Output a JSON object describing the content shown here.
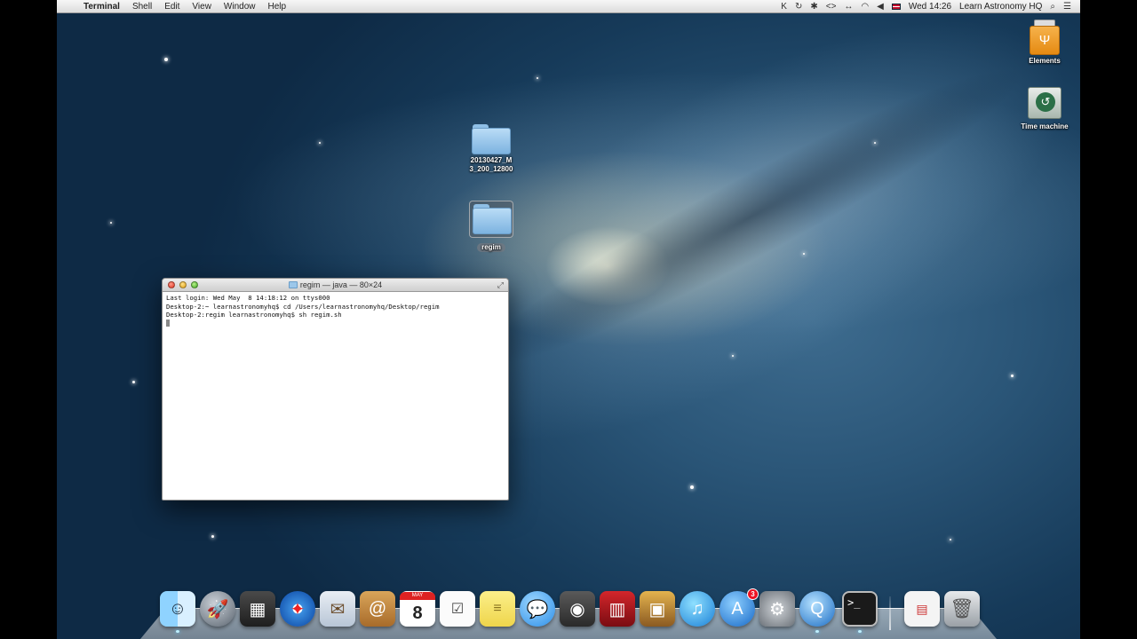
{
  "menubar": {
    "apple_glyph": "",
    "app_name": "Terminal",
    "menus": [
      "Shell",
      "Edit",
      "View",
      "Window",
      "Help"
    ],
    "clock": "Wed 14:26",
    "user": "Learn Astronomy HQ"
  },
  "desktop_icons": {
    "folder1": "20130427_M 3_200_12800",
    "folder2": "regim",
    "drive1": "Elements",
    "drive2": "Time machine"
  },
  "terminal": {
    "title": "regim — java — 80×24",
    "lines": [
      "Last login: Wed May  8 14:18:12 on ttys000",
      "Desktop-2:~ learnastronomyhq$ cd /Users/learnastronomyhq/Desktop/regim",
      "Desktop-2:regim learnastronomyhq$ sh regim.sh"
    ]
  },
  "dock": {
    "app_store_badge": "3",
    "calendar_day": "8",
    "calendar_month": "MAY"
  }
}
